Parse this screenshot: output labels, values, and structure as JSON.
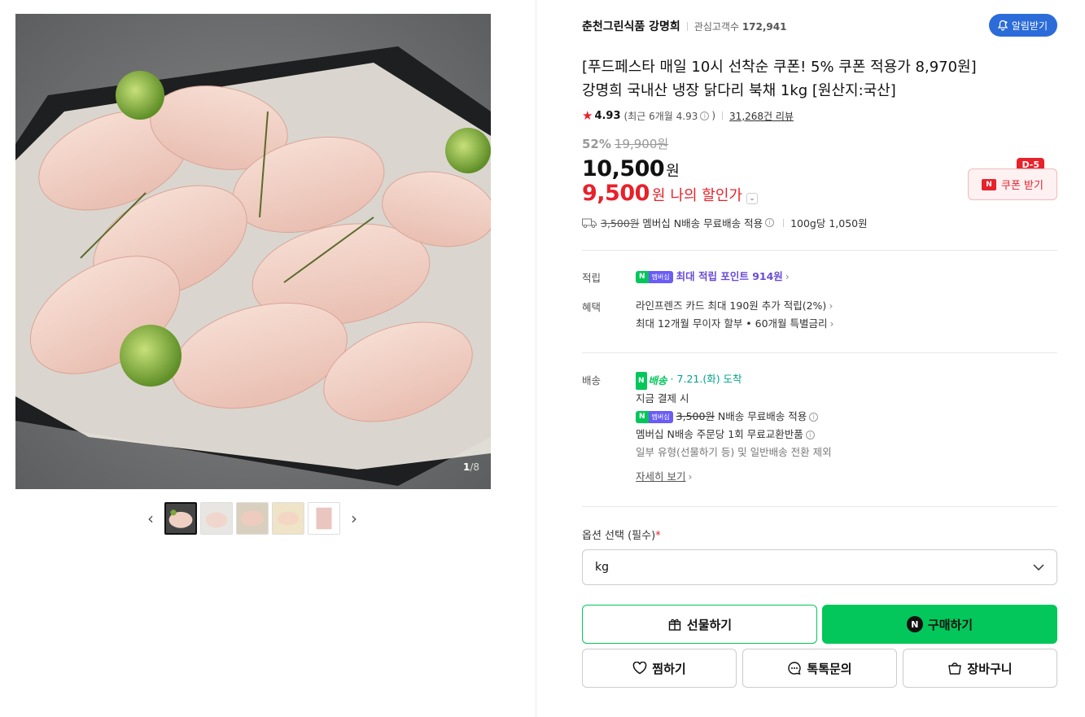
{
  "gallery": {
    "counter_current": "1",
    "counter_total": "/8",
    "prev_label": "‹",
    "next_label": "›"
  },
  "store": {
    "name": "춘천그린식품 강명희",
    "follow_label": "관심고객수",
    "follow_count": "172,941",
    "alarm_label": "알림받기"
  },
  "product": {
    "title_line1": "[푸드페스타 매일 10시 선착순 쿠폰! 5% 쿠폰 적용가 8,970원]",
    "title_line2": "강명희 국내산 냉장 닭다리 북채 1kg [원산지:국산]",
    "rating": "4.93",
    "rating_recent": "(최근 6개월 4.93",
    "rating_recent_close": ")",
    "review_count": "31,268건 리뷰",
    "discount_pct": "52%",
    "original_price": "19,900원",
    "price": "10,500",
    "price_unit": "원",
    "my_price": "9,500",
    "my_price_unit": "원",
    "my_price_label": "나의 할인가",
    "coupon_label": "쿠폰 받기",
    "coupon_dday": "D-5",
    "ship_fee_strike": "3,500원",
    "ship_text": "멤버십 N배송 무료배송 적용",
    "unit_price": "100g당 1,050원"
  },
  "benefits": {
    "points_label": "적립",
    "points_text": "최대 적립 포인트 914원",
    "benefit_label": "혜택",
    "benefit_line1": "라인프렌즈 카드 최대 190원 추가 적립(2%)",
    "benefit_line2": "최대 12개월 무이자 할부 • 60개월 특별금리"
  },
  "delivery": {
    "label": "배송",
    "badge": "배송",
    "arrival": "7.21.(화) 도착",
    "line1": "지금 결제 시",
    "line2_strike": "3,500원",
    "line2": "N배송 무료배송 적용",
    "line3": "멤버십 N배송 주문당 1회 무료교환반품",
    "line4": "일부 유형(선물하기 등) 및 일반배송 전환 제외",
    "more": "자세히 보기"
  },
  "options": {
    "label": "옵션 선택 (필수)",
    "required_mark": "*",
    "selected": "kg"
  },
  "actions": {
    "gift": "선물하기",
    "buy": "구매하기",
    "wish": "찜하기",
    "talk": "톡톡문의",
    "cart": "장바구니"
  },
  "badges": {
    "n": "N",
    "membership": "멤버십"
  },
  "colors": {
    "naver_green": "#03c75a",
    "accent_red": "#e8212b",
    "alarm_blue": "#2b6cd9",
    "points_purple": "#6a4bd8"
  }
}
